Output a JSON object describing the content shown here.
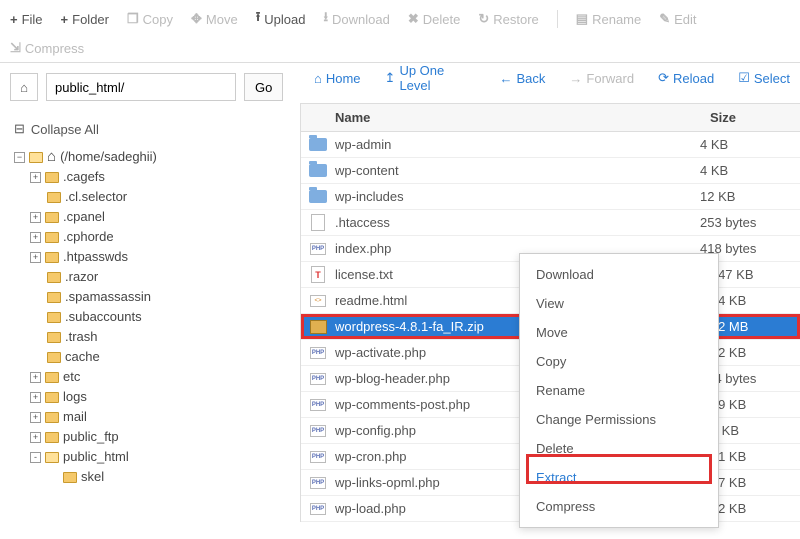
{
  "toolbar": {
    "file": "File",
    "folder": "Folder",
    "copy": "Copy",
    "move": "Move",
    "upload": "Upload",
    "download": "Download",
    "delete": "Delete",
    "restore": "Restore",
    "rename": "Rename",
    "edit": "Edit",
    "compress": "Compress"
  },
  "path": {
    "value": "public_html/",
    "go": "Go"
  },
  "midnav": {
    "home": "Home",
    "up": "Up One Level",
    "back": "Back",
    "forward": "Forward",
    "reload": "Reload",
    "select": "Select"
  },
  "sidebar": {
    "collapse_all": "Collapse All",
    "root": "(/home/sadeghii)",
    "nodes": [
      {
        "label": ".cagefs",
        "toggle": "+"
      },
      {
        "label": ".cl.selector"
      },
      {
        "label": ".cpanel",
        "toggle": "+"
      },
      {
        "label": ".cphorde",
        "toggle": "+"
      },
      {
        "label": ".htpasswds",
        "toggle": "+"
      },
      {
        "label": ".razor"
      },
      {
        "label": ".spamassassin"
      },
      {
        "label": ".subaccounts"
      },
      {
        "label": ".trash"
      },
      {
        "label": "cache"
      },
      {
        "label": "etc",
        "toggle": "+"
      },
      {
        "label": "logs",
        "toggle": "+"
      },
      {
        "label": "mail",
        "toggle": "+"
      },
      {
        "label": "public_ftp",
        "toggle": "+"
      },
      {
        "label": "public_html",
        "toggle": "-",
        "open": true
      },
      {
        "label": "skel",
        "indent": true
      }
    ]
  },
  "table": {
    "col_name": "Name",
    "col_size": "Size",
    "rows": [
      {
        "icon": "folder",
        "name": "wp-admin",
        "size": "4 KB"
      },
      {
        "icon": "folder",
        "name": "wp-content",
        "size": "4 KB"
      },
      {
        "icon": "folder",
        "name": "wp-includes",
        "size": "12 KB"
      },
      {
        "icon": "file",
        "name": ".htaccess",
        "size": "253 bytes"
      },
      {
        "icon": "php",
        "name": "index.php",
        "size": "418 bytes"
      },
      {
        "icon": "txt",
        "name": "license.txt",
        "size": "19.47 KB"
      },
      {
        "icon": "html",
        "name": "readme.html",
        "size": "7.24 KB"
      },
      {
        "icon": "zip",
        "name": "wordpress-4.8.1-fa_IR.zip",
        "size": "6.22 MB",
        "selected": true
      },
      {
        "icon": "php",
        "name": "wp-activate.php",
        "size": "5.32 KB"
      },
      {
        "icon": "php",
        "name": "wp-blog-header.php",
        "size": "364 bytes"
      },
      {
        "icon": "php",
        "name": "wp-comments-post.php",
        "size": "1.59 KB"
      },
      {
        "icon": "php",
        "name": "wp-config.php",
        "size": "2.7 KB"
      },
      {
        "icon": "php",
        "name": "wp-cron.php",
        "size": "3.21 KB"
      },
      {
        "icon": "php",
        "name": "wp-links-opml.php",
        "size": "2.37 KB"
      },
      {
        "icon": "php",
        "name": "wp-load.php",
        "size": "3.22 KB"
      }
    ]
  },
  "context_menu": {
    "items": [
      {
        "label": "Download"
      },
      {
        "label": "View"
      },
      {
        "label": "Move"
      },
      {
        "label": "Copy"
      },
      {
        "label": "Rename"
      },
      {
        "label": "Change Permissions"
      },
      {
        "label": "Delete"
      },
      {
        "label": "Extract",
        "highlight": true
      },
      {
        "label": "Compress"
      }
    ]
  }
}
